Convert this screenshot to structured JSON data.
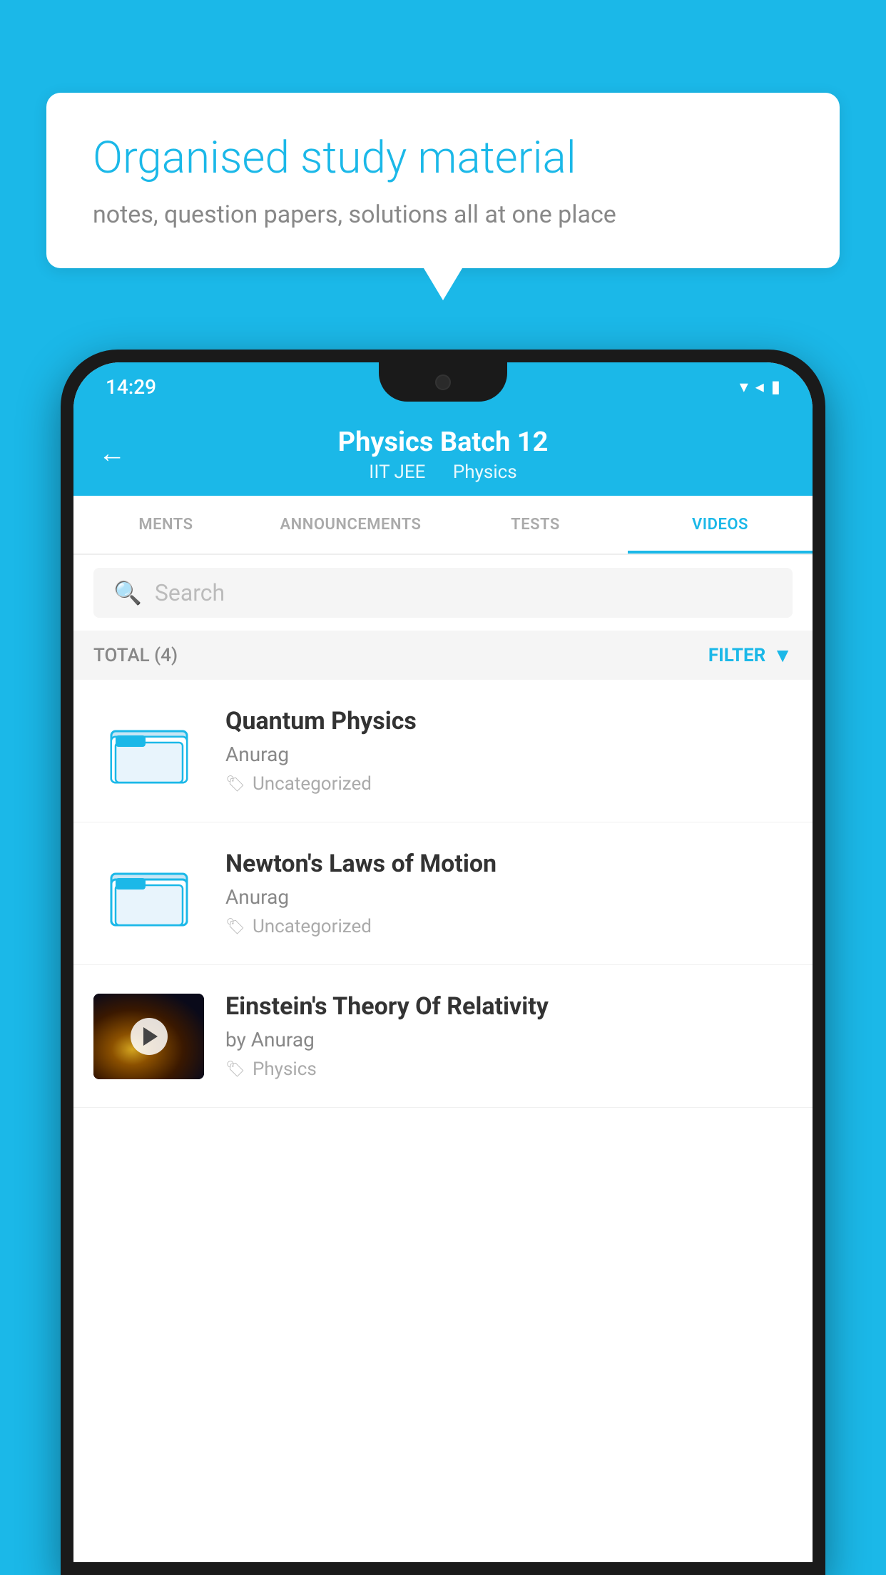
{
  "background_color": "#1BB8E8",
  "speech_bubble": {
    "title": "Organised study material",
    "subtitle": "notes, question papers, solutions all at one place"
  },
  "status_bar": {
    "time": "14:29"
  },
  "app_header": {
    "title": "Physics Batch 12",
    "subtitle_tag1": "IIT JEE",
    "subtitle_tag2": "Physics",
    "back_label": "←"
  },
  "tabs": [
    {
      "label": "MENTS",
      "active": false
    },
    {
      "label": "ANNOUNCEMENTS",
      "active": false
    },
    {
      "label": "TESTS",
      "active": false
    },
    {
      "label": "VIDEOS",
      "active": true
    }
  ],
  "search": {
    "placeholder": "Search"
  },
  "filter_bar": {
    "total_label": "TOTAL (4)",
    "filter_label": "FILTER"
  },
  "videos": [
    {
      "title": "Quantum Physics",
      "author": "Anurag",
      "tag": "Uncategorized",
      "type": "folder"
    },
    {
      "title": "Newton's Laws of Motion",
      "author": "Anurag",
      "tag": "Uncategorized",
      "type": "folder"
    },
    {
      "title": "Einstein's Theory Of Relativity",
      "author": "by Anurag",
      "tag": "Physics",
      "type": "video"
    }
  ]
}
